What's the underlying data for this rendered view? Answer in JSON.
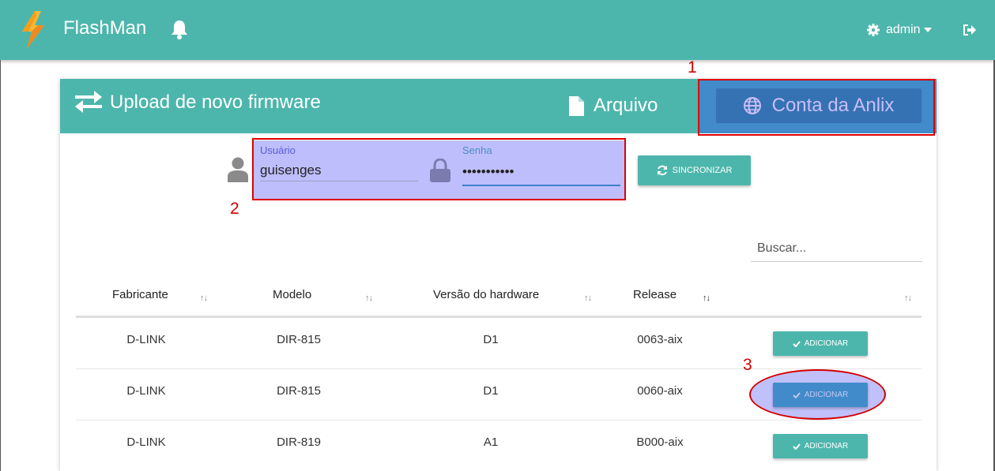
{
  "topbar": {
    "brand": "FlashMan",
    "user_label": "admin",
    "icons": {
      "logo": "lightning-logo",
      "bell": "bell-icon",
      "settings": "gear-icon",
      "logout": "logout-icon"
    },
    "bg_color": "#4db6ac"
  },
  "card": {
    "title": "Upload de novo firmware",
    "tabs": [
      {
        "label": "Arquivo",
        "icon": "file-icon",
        "active": false
      },
      {
        "label": "Conta da Anlix",
        "icon": "globe-icon",
        "active": true
      }
    ]
  },
  "login": {
    "username_label": "Usuário",
    "username_value": "guisenges",
    "password_label": "Senha",
    "password_value": "•••••••••••",
    "sync_label": "SINCRONIZAR"
  },
  "search": {
    "placeholder": "Buscar..."
  },
  "table": {
    "columns": [
      "Fabricante",
      "Modelo",
      "Versão do hardware",
      "Release"
    ],
    "sort_glyph": "↑↓",
    "rows": [
      {
        "fabricante": "D-LINK",
        "modelo": "DIR-815",
        "versao": "D1",
        "release": "0063-aix",
        "action": "ADICIONAR"
      },
      {
        "fabricante": "D-LINK",
        "modelo": "DIR-815",
        "versao": "D1",
        "release": "0060-aix",
        "action": "ADICIONAR"
      },
      {
        "fabricante": "D-LINK",
        "modelo": "DIR-819",
        "versao": "A1",
        "release": "B000-aix",
        "action": "ADICIONAR"
      }
    ]
  },
  "annotations": [
    "1",
    "2",
    "3"
  ]
}
